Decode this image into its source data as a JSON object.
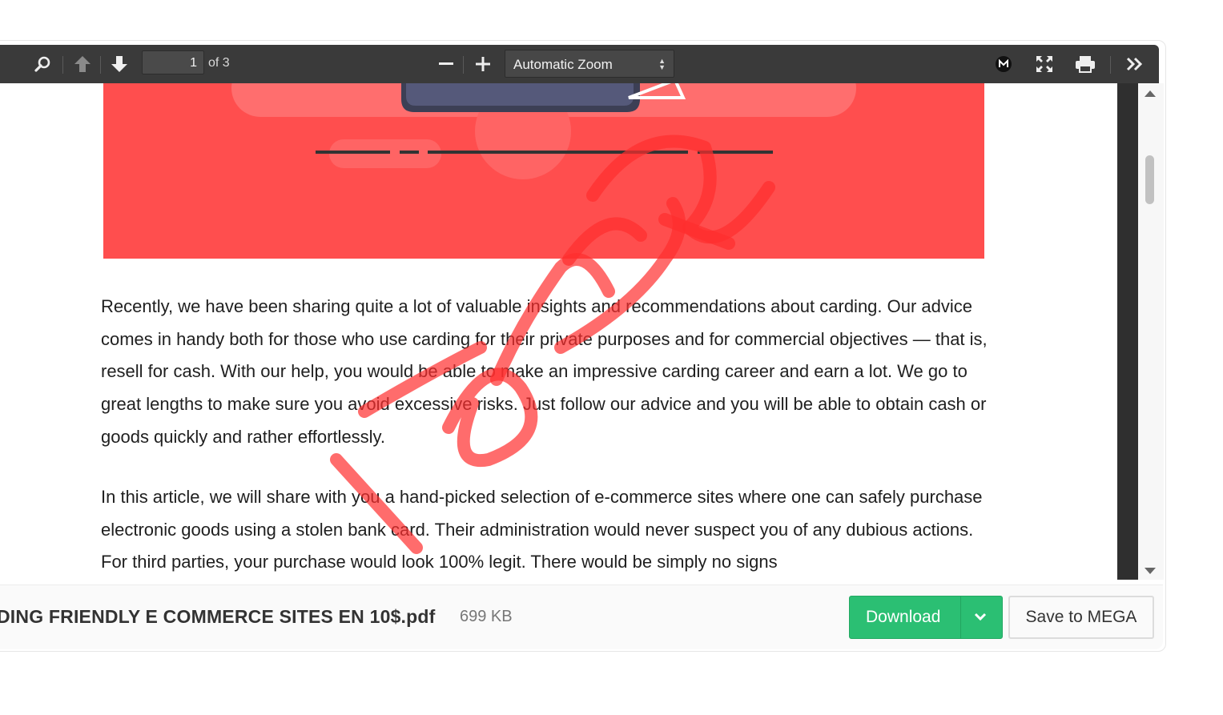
{
  "toolbar": {
    "page_current": "1",
    "page_of": "of 3",
    "zoom_selected": "Automatic Zoom",
    "icons": [
      "search-icon",
      "previous-page-icon",
      "next-page-icon",
      "zoom-out-icon",
      "zoom-in-icon",
      "mega-icon",
      "fullscreen-icon",
      "print-icon",
      "more-tools-icon"
    ]
  },
  "document": {
    "paragraphs": [
      "Recently, we have been sharing quite a lot of valuable insights and recommendations about carding. Our advice comes in handy both for those who use carding for their private purposes and for commercial objectives — that is, resell for cash. With our help, you would be able to make an impressive carding career and earn a lot. We go to great lengths to make sure you avoid excessive risks. Just follow our advice and you will be able to obtain cash or goods quickly and rather effortlessly.",
      "In this article, we will share with you a hand-picked selection of e-commerce sites where one can safely purchase electronic goods using a stolen bank card. Their administration would never suspect you of any dubious actions. For third parties, your purchase would look 100% legit. There would be simply no signs"
    ],
    "hero_color": "#ff4e4e",
    "stamp_color": "#ff2d2d"
  },
  "footer": {
    "file_name": "DING FRIENDLY E COMMERCE SITES EN 10$.pdf",
    "file_size": "699 KB",
    "download_label": "Download",
    "save_label": "Save to MEGA",
    "download_color": "#2bbf73"
  }
}
